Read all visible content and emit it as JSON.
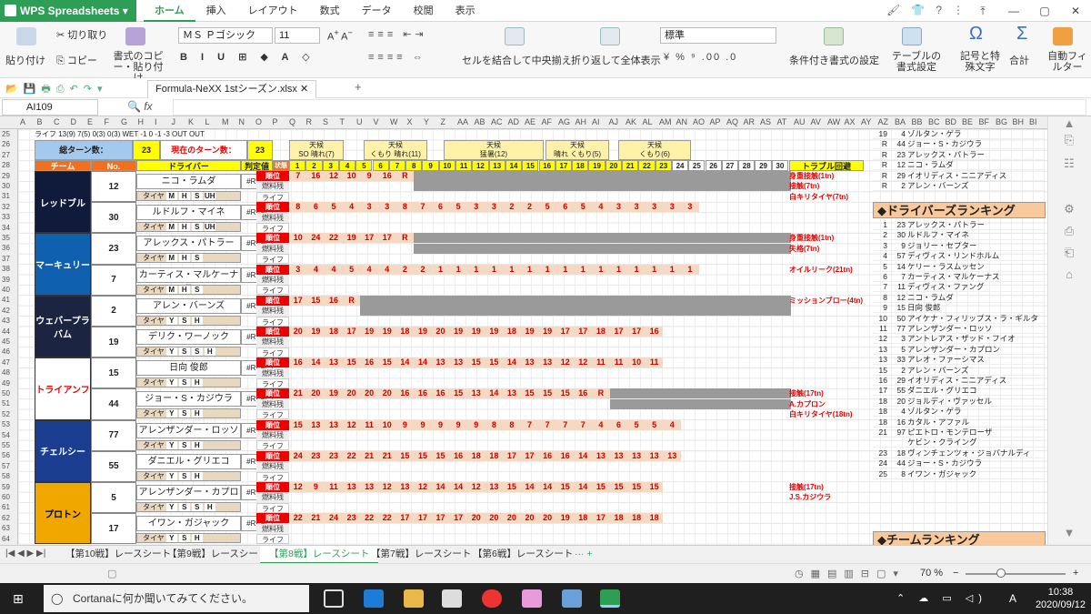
{
  "app": {
    "name": "WPS Spreadsheets"
  },
  "menu_tabs": [
    "ホーム",
    "挿入",
    "レイアウト",
    "数式",
    "データ",
    "校閲",
    "表示"
  ],
  "ribbon": {
    "paste": "貼り付け",
    "cut": "切り取り",
    "copy": "コピー",
    "format_copy": "書式のコピー・貼り付け",
    "font_name": "ＭＳ Ｐゴシック",
    "font_size": "11",
    "merge": "セルを結合して中央揃え",
    "wrap": "折り返して全体表示",
    "number_format": "標準",
    "conditional": "条件付き書式の設定",
    "table_style": "テーブルの書式設定",
    "symbol": "記号と特殊文字",
    "sum": "合計",
    "autofilter": "自動フィルター"
  },
  "file_tab": "Formula-NeXX 1stシーズン.xlsx",
  "name_box": "AI109",
  "fx_label": "fx",
  "header_rows": {
    "row25": "ライフ  13(9)  7(5)  0(3)  0(3)   WET  -1  0  -1  -3  OUT  OUT",
    "total_laps_label": "総ターン数：",
    "total_laps": "23",
    "current_lap_label": "現在のターン数：",
    "current_lap": "23",
    "weather": "天候",
    "weather_notes": [
      "SO 晴れ(7)",
      "くもり 晴れ(11)",
      "猛暑(12)",
      "晴れ くもり(5)",
      "くもり(6)"
    ],
    "cols": {
      "team": "チーム",
      "no": "No.",
      "driver": "ドライバー",
      "judge": "判定値",
      "state": "状態"
    },
    "laps": [
      "1",
      "2",
      "3",
      "4",
      "5",
      "6",
      "7",
      "8",
      "9",
      "10",
      "11",
      "12",
      "13",
      "14",
      "15",
      "16",
      "17",
      "18",
      "19",
      "20",
      "21",
      "22",
      "23",
      "24",
      "25",
      "26",
      "27",
      "28",
      "29",
      "30"
    ],
    "trouble_header": "トラブル回避"
  },
  "row_labels": {
    "pos": "順位",
    "fuel": "燃料残",
    "life": "ライフ",
    "tire": "タイヤ",
    "ref": "#REF!"
  },
  "teams": [
    {
      "name": "レッドブル",
      "color": "#101a3a",
      "drivers": [
        {
          "no": "12",
          "name": "ニコ・ラムダ",
          "tires": [
            "M",
            "H",
            "S",
            "UH"
          ],
          "pos": [
            "7",
            "16",
            "12",
            "10",
            "9",
            "16",
            "R"
          ],
          "trouble": [
            "身重接触(1tn)",
            "接触(7tn)",
            "白キリタイヤ(7tn)"
          ]
        },
        {
          "no": "30",
          "name": "ルドルフ・マイネ",
          "tires": [
            "M",
            "H",
            "S",
            "UH"
          ],
          "pos": [
            "8",
            "6",
            "5",
            "4",
            "3",
            "3",
            "8",
            "7",
            "6",
            "5",
            "3",
            "3",
            "2",
            "2",
            "5",
            "6",
            "5",
            "4",
            "3",
            "3",
            "3",
            "3",
            "3"
          ],
          "trouble": []
        }
      ]
    },
    {
      "name": "マーキュリー",
      "color": "#1060b0",
      "drivers": [
        {
          "no": "23",
          "name": "アレックス・パトラー",
          "tires": [
            "M",
            "H",
            "S"
          ],
          "pos": [
            "10",
            "24",
            "22",
            "19",
            "17",
            "17",
            "R"
          ],
          "trouble": [
            "身重接触(1tn)",
            "失格(7tn)"
          ]
        },
        {
          "no": "7",
          "name": "カーティス・マルケーナス",
          "tires": [
            "M",
            "H",
            "S"
          ],
          "pos": [
            "3",
            "4",
            "4",
            "5",
            "4",
            "4",
            "2",
            "2",
            "1",
            "1",
            "1",
            "1",
            "1",
            "1",
            "1",
            "1",
            "1",
            "1",
            "1",
            "1",
            "1",
            "1",
            "1"
          ],
          "trouble": [
            "オイルリーク(21tn)"
          ]
        }
      ]
    },
    {
      "name": "ウェバープラバム",
      "color": "#1b2440",
      "drivers": [
        {
          "no": "2",
          "name": "アレン・バーンズ",
          "tires": [
            "Y",
            "S",
            "H"
          ],
          "pos": [
            "17",
            "15",
            "16",
            "R"
          ],
          "trouble": [
            "ミッションブロー(4tn)"
          ]
        },
        {
          "no": "19",
          "name": "デリク・ワーノック",
          "tires": [
            "Y",
            "S",
            "S",
            "H"
          ],
          "pos": [
            "20",
            "19",
            "18",
            "17",
            "19",
            "19",
            "18",
            "19",
            "20",
            "19",
            "19",
            "19",
            "18",
            "19",
            "19",
            "17",
            "17",
            "18",
            "17",
            "17",
            "16"
          ],
          "trouble": []
        }
      ]
    },
    {
      "name": "トライアンフ",
      "color": "#ffffff",
      "textcolor": "#e00",
      "drivers": [
        {
          "no": "15",
          "name": "日向 俊郎",
          "tires": [
            "Y",
            "S",
            "H"
          ],
          "pos": [
            "16",
            "14",
            "13",
            "15",
            "16",
            "15",
            "14",
            "14",
            "13",
            "13",
            "15",
            "15",
            "14",
            "13",
            "13",
            "12",
            "12",
            "11",
            "11",
            "10",
            "11"
          ],
          "trouble": []
        },
        {
          "no": "44",
          "name": "ジョー・S・カジウラ",
          "tires": [
            "Y",
            "S",
            "H"
          ],
          "pos": [
            "21",
            "20",
            "19",
            "20",
            "20",
            "20",
            "16",
            "16",
            "16",
            "15",
            "13",
            "14",
            "13",
            "15",
            "15",
            "15",
            "16",
            "R"
          ],
          "trouble": [
            "接触(17tn)",
            "A.カプロン",
            "白キリタイヤ(18tn)"
          ]
        }
      ]
    },
    {
      "name": "チェルシー",
      "color": "#1b3e90",
      "drivers": [
        {
          "no": "77",
          "name": "アレンザンダー・ロッソ",
          "tires": [
            "Y",
            "S",
            "H"
          ],
          "pos": [
            "15",
            "13",
            "13",
            "12",
            "11",
            "10",
            "9",
            "9",
            "9",
            "9",
            "9",
            "8",
            "8",
            "7",
            "7",
            "7",
            "7",
            "4",
            "6",
            "5",
            "5",
            "4"
          ],
          "trouble": []
        },
        {
          "no": "55",
          "name": "ダニエル・グリエコ",
          "tires": [
            "Y",
            "S",
            "H"
          ],
          "pos": [
            "24",
            "23",
            "23",
            "22",
            "21",
            "21",
            "15",
            "15",
            "15",
            "16",
            "18",
            "18",
            "17",
            "17",
            "16",
            "16",
            "14",
            "13",
            "13",
            "13",
            "13",
            "13"
          ],
          "trouble": []
        }
      ]
    },
    {
      "name": "プロトン",
      "color": "#f0a800",
      "textcolor": "#000",
      "drivers": [
        {
          "no": "5",
          "name": "アレンザンダー・カプロン",
          "tires": [
            "Y",
            "S",
            "S",
            "H"
          ],
          "pos": [
            "12",
            "9",
            "11",
            "13",
            "13",
            "12",
            "13",
            "12",
            "14",
            "14",
            "12",
            "13",
            "15",
            "14",
            "14",
            "15",
            "14",
            "15",
            "15",
            "15",
            "15"
          ],
          "trouble": [
            "接触(17tn)",
            "J.S.カジウラ"
          ]
        },
        {
          "no": "17",
          "name": "イワン・ガジャック",
          "tires": [
            "Y",
            "S",
            "H"
          ],
          "pos": [
            "22",
            "21",
            "24",
            "23",
            "22",
            "22",
            "17",
            "17",
            "17",
            "17",
            "20",
            "20",
            "20",
            "20",
            "20",
            "19",
            "18",
            "17",
            "18",
            "18",
            "18"
          ],
          "trouble": []
        }
      ]
    }
  ],
  "ranking_top": [
    {
      "a": "19",
      "b": "4",
      "n": "ゾルタン・ゲラ"
    },
    {
      "a": "R",
      "b": "44",
      "n": "ジョー・S・カジウラ"
    },
    {
      "a": "R",
      "b": "23",
      "n": "アレックス・パトラー"
    },
    {
      "a": "R",
      "b": "12",
      "n": "ニコ・ラムダ"
    },
    {
      "a": "R",
      "b": "29",
      "n": "イオリディス・ニニアディス"
    },
    {
      "a": "R",
      "b": "2",
      "n": "アレン・バーンズ"
    }
  ],
  "driver_ranking_title": "◆ドライバーズランキング",
  "driver_ranking": [
    {
      "a": "1",
      "b": "23",
      "n": "アレックス・パトラー"
    },
    {
      "a": "2",
      "b": "30",
      "n": "ルドルフ・マイネ"
    },
    {
      "a": "3",
      "b": "9",
      "n": "ジョリー・セプター"
    },
    {
      "a": "4",
      "b": "57",
      "n": "ディヴィス・リンドホルム"
    },
    {
      "a": "5",
      "b": "14",
      "n": "ケリー・ラスムッセン"
    },
    {
      "a": "6",
      "b": "7",
      "n": "カーティス・マルケーナス"
    },
    {
      "a": "7",
      "b": "11",
      "n": "ディヴィス・ファング"
    },
    {
      "a": "8",
      "b": "12",
      "n": "ニコ・ラムダ"
    },
    {
      "a": "9",
      "b": "15",
      "n": "日向 俊郎"
    },
    {
      "a": "10",
      "b": "50",
      "n": "アイケナ・フィリップス・ラ・ギルタ"
    },
    {
      "a": "11",
      "b": "77",
      "n": "アレンザンダー・ロッソ"
    },
    {
      "a": "12",
      "b": "3",
      "n": "アントレアス・ザッド・フイオ"
    },
    {
      "a": "13",
      "b": "5",
      "n": "アレンザンダー・カプロン"
    },
    {
      "a": "13",
      "b": "33",
      "n": "アレオ・ファーシマス"
    },
    {
      "a": "15",
      "b": "2",
      "n": "アレン・バーンズ"
    },
    {
      "a": "16",
      "b": "29",
      "n": "イオリディス・ニニアディス"
    },
    {
      "a": "17",
      "b": "55",
      "n": "ダニエル・グリエコ"
    },
    {
      "a": "18",
      "b": "20",
      "n": "ジョルディ・ヴァッセル"
    },
    {
      "a": "18",
      "b": "4",
      "n": "ゾルタン・ゲラ"
    },
    {
      "a": "18",
      "b": "16",
      "n": "カタル・アファル"
    },
    {
      "a": "21",
      "b": "97",
      "n": "ピエトロ・モンテローザ"
    },
    {
      "a": "",
      "b": "",
      "n": "ケビン・クライング"
    },
    {
      "a": "23",
      "b": "18",
      "n": "ヴィンチェンツォ・ジョバナルディ"
    },
    {
      "a": "24",
      "b": "44",
      "n": "ジョー・S・カジウラ"
    },
    {
      "a": "25",
      "b": "8",
      "n": "イワン・ガジャック"
    }
  ],
  "team_ranking_title": "◆チームランキング",
  "sheet_tabs": [
    "【第10戦】レースシート",
    "【第9戦】レースシート",
    "【第8戦】レースシート",
    "【第7戦】レースシート",
    "【第6戦】レースシート"
  ],
  "active_tab": 2,
  "status": {
    "zoom": "70 %"
  },
  "taskbar": {
    "search": "Cortanaに何か聞いてみてください。",
    "time": "10:38",
    "date": "2020/09/12",
    "ime": "A"
  }
}
